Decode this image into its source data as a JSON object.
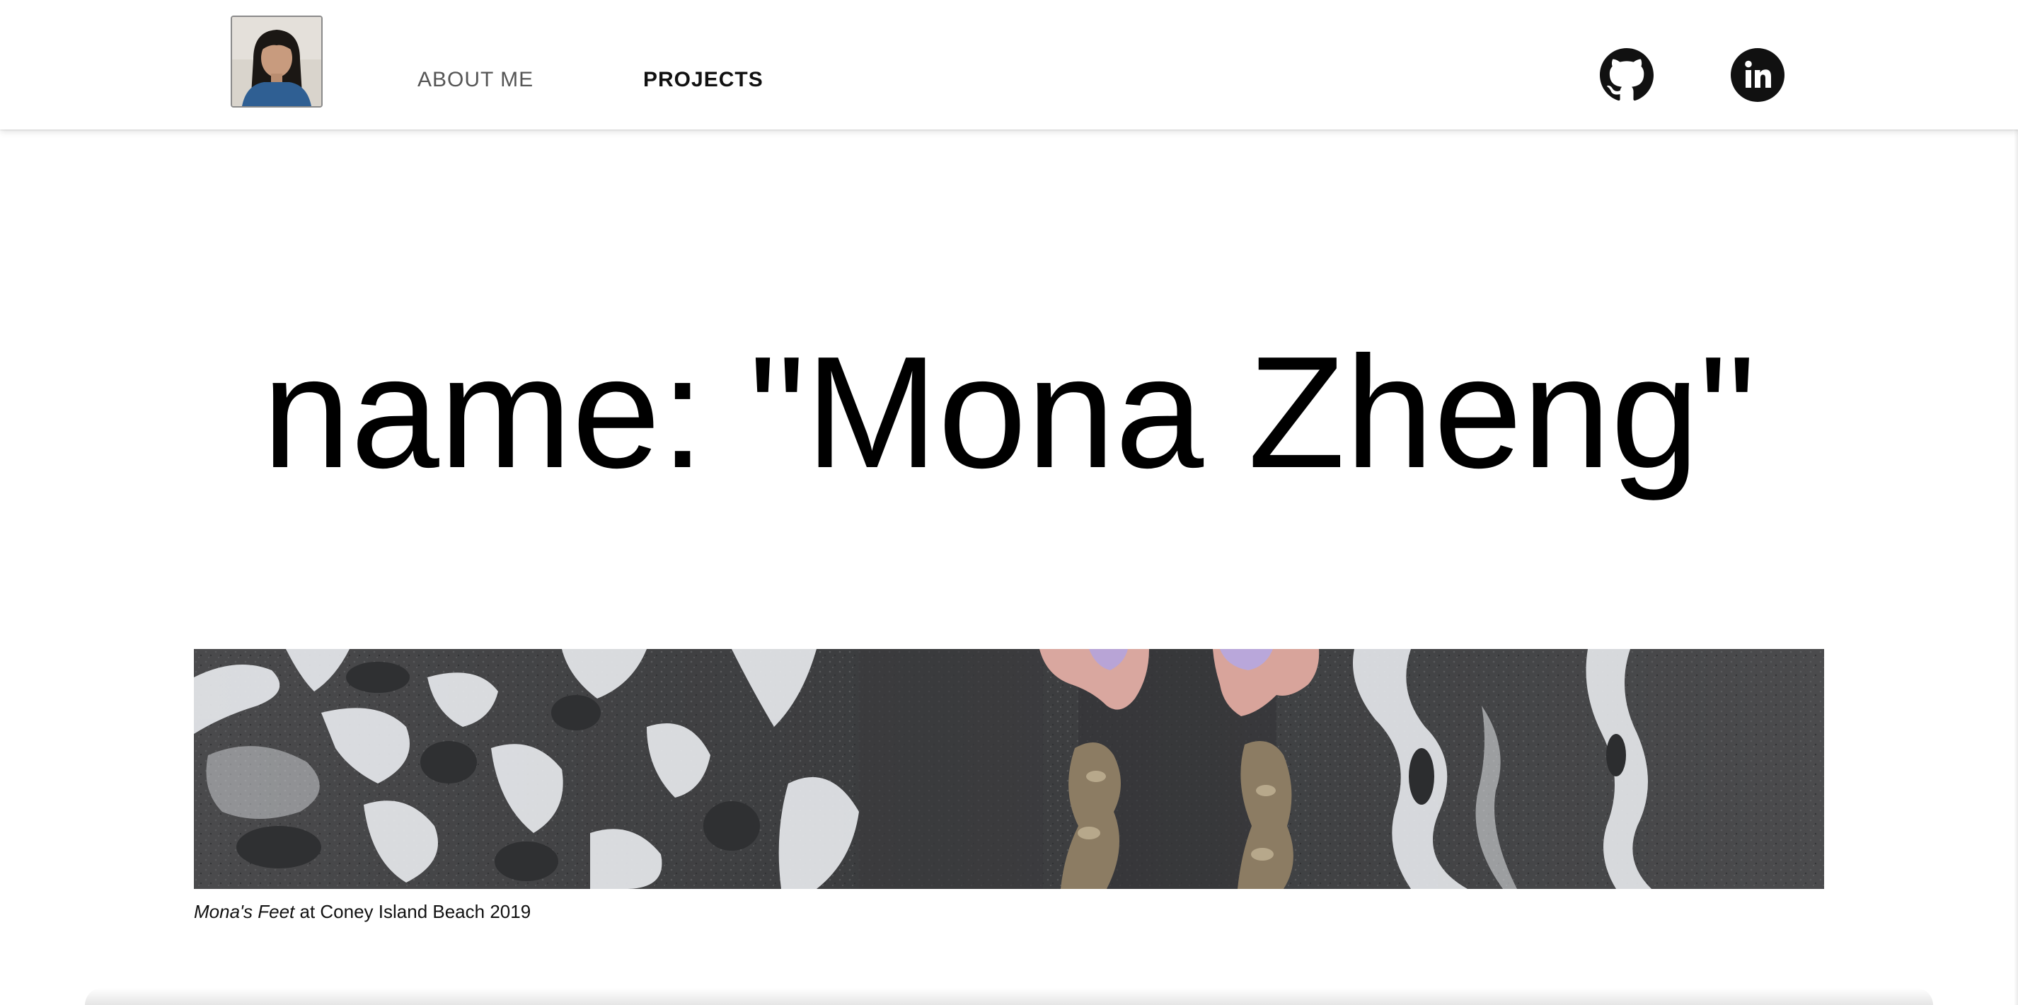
{
  "header": {
    "nav": {
      "about_label": "ABOUT ME",
      "projects_label": "PROJECTS"
    },
    "avatar_alt": "profile photo",
    "social": {
      "github_icon": "github-icon",
      "linkedin_icon": "linkedin-icon"
    }
  },
  "hero": {
    "title": "name: \"Mona Zheng\""
  },
  "banner": {
    "caption_italic": "Mona's Feet",
    "caption_rest": " at Coney Island Beach 2019"
  },
  "colors": {
    "text": "#000000",
    "nav_inactive": "#555555",
    "nav_active": "#111111",
    "background": "#ffffff"
  }
}
